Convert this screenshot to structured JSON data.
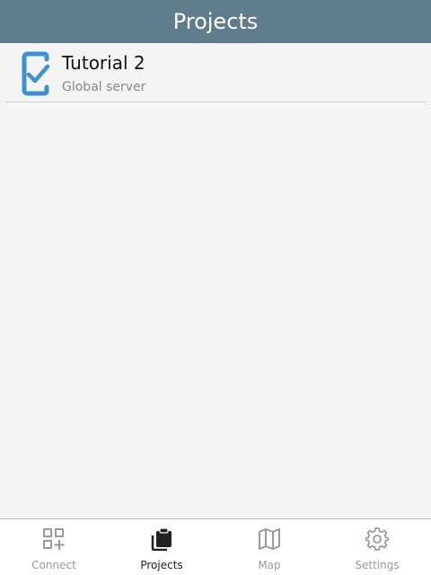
{
  "header": {
    "title": "Projects"
  },
  "projects": [
    {
      "title": "Tutorial 2",
      "subtitle": "Global server",
      "icon": "checklist-icon"
    }
  ],
  "bottom_nav": {
    "items": [
      {
        "label": "Connect",
        "icon": "qr-code-icon",
        "active": false
      },
      {
        "label": "Projects",
        "icon": "clipboard-icon",
        "active": true
      },
      {
        "label": "Map",
        "icon": "map-icon",
        "active": false
      },
      {
        "label": "Settings",
        "icon": "gear-icon",
        "active": false
      }
    ]
  },
  "colors": {
    "header_bg": "#607d8b",
    "accent_blue": "#3f8fd3",
    "active_icon": "#222222",
    "inactive_icon": "#9a9a9a",
    "background": "#f4f4f4"
  }
}
